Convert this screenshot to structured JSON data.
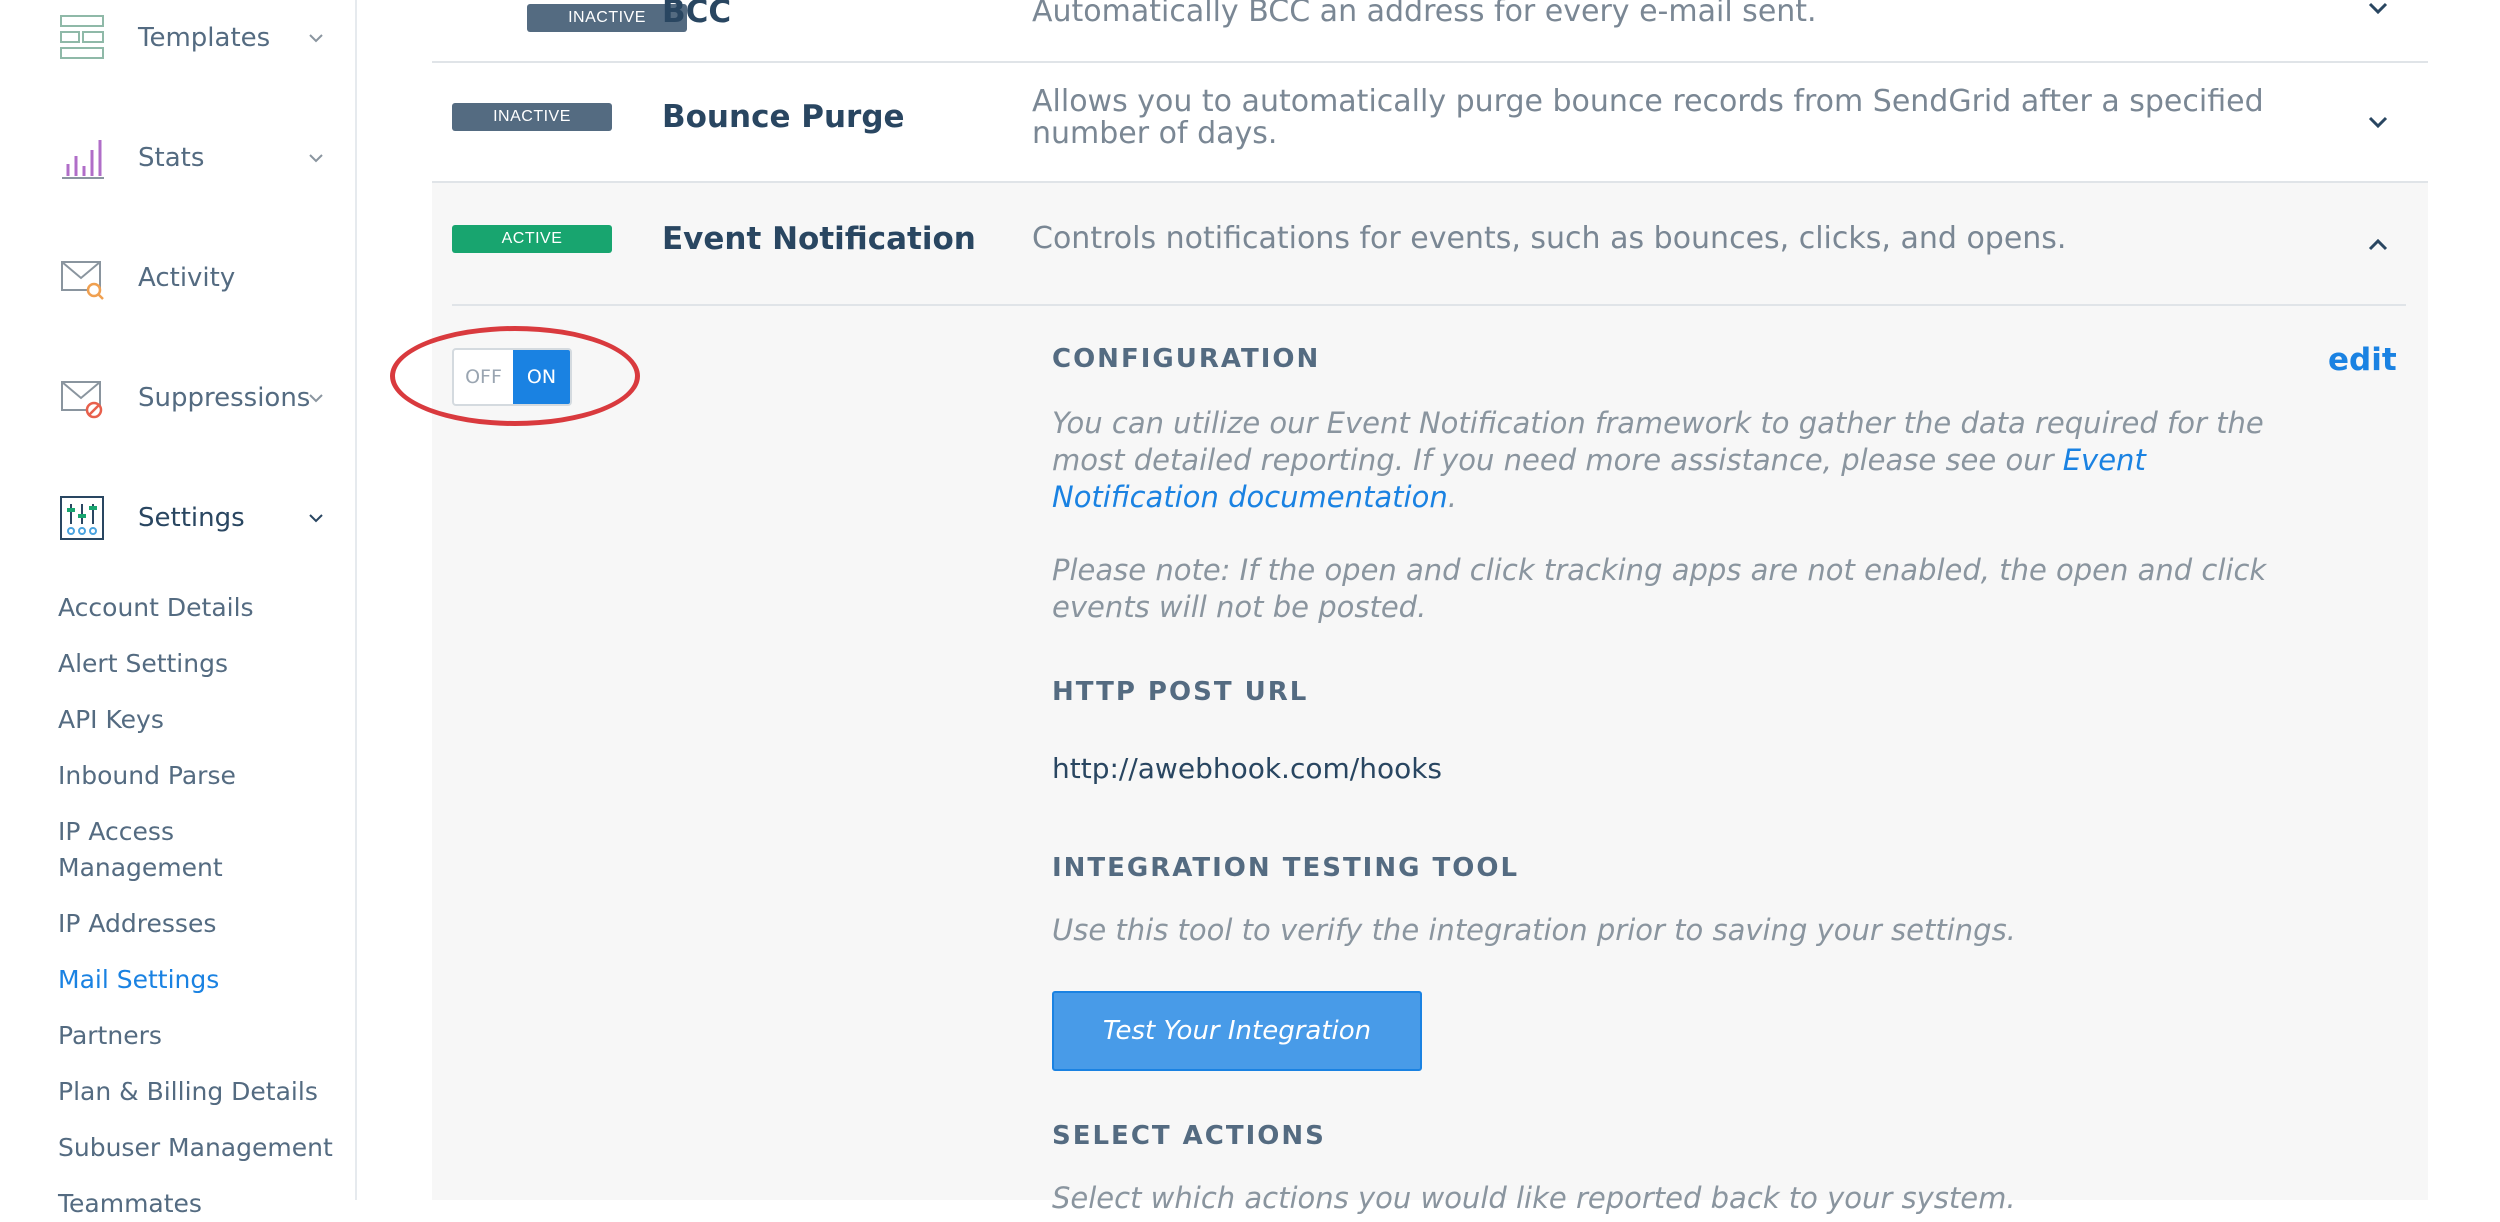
{
  "sidebar": {
    "nav": [
      {
        "label": "Templates",
        "icon": "templates-icon"
      },
      {
        "label": "Stats",
        "icon": "stats-icon"
      },
      {
        "label": "Activity",
        "icon": "activity-icon"
      },
      {
        "label": "Suppressions",
        "icon": "suppressions-icon"
      },
      {
        "label": "Settings",
        "icon": "settings-icon"
      }
    ],
    "settings_items": [
      "Account Details",
      "Alert Settings",
      "API Keys",
      "Inbound Parse",
      "IP Access",
      "Management",
      "IP Addresses",
      "Mail Settings",
      "Partners",
      "Plan & Billing Details",
      "Subuser Management",
      "Teammates"
    ],
    "active_item": "Mail Settings"
  },
  "rows": [
    {
      "badge": "INACTIVE",
      "title": "BCC",
      "desc": "Automatically BCC an address for every e-mail sent."
    },
    {
      "badge": "INACTIVE",
      "title": "Bounce Purge",
      "desc": "Allows you to automatically purge bounce records from SendGrid after a specified number of days."
    },
    {
      "badge": "ACTIVE",
      "title": "Event Notification",
      "desc": "Controls notifications for events, such as bounces, clicks, and opens."
    }
  ],
  "toggle": {
    "off": "OFF",
    "on": "ON",
    "state": "on"
  },
  "config": {
    "heading": "CONFIGURATION",
    "edit": "edit",
    "intro_before": "You can utilize our Event Notification framework to gather the data required for the most detailed reporting. If you need more assistance, please see our ",
    "intro_link": "Event Notification documentation",
    "intro_after": ".",
    "note": "Please note: If the open and click tracking apps are not enabled, the open and click events will not be posted.",
    "url_heading": "HTTP POST URL",
    "url_value": "http://awebhook.com/hooks",
    "testing_heading": "INTEGRATION TESTING TOOL",
    "testing_desc": "Use this tool to verify the integration prior to saving your settings.",
    "test_button": "Test Your Integration",
    "actions_heading": "SELECT ACTIONS",
    "actions_desc": "Select which actions you would like reported back to your system."
  },
  "colors": {
    "accent": "#1a82e2",
    "active_badge": "#18a56f",
    "inactive_badge": "#546b81",
    "annotation": "#d93a3e"
  }
}
